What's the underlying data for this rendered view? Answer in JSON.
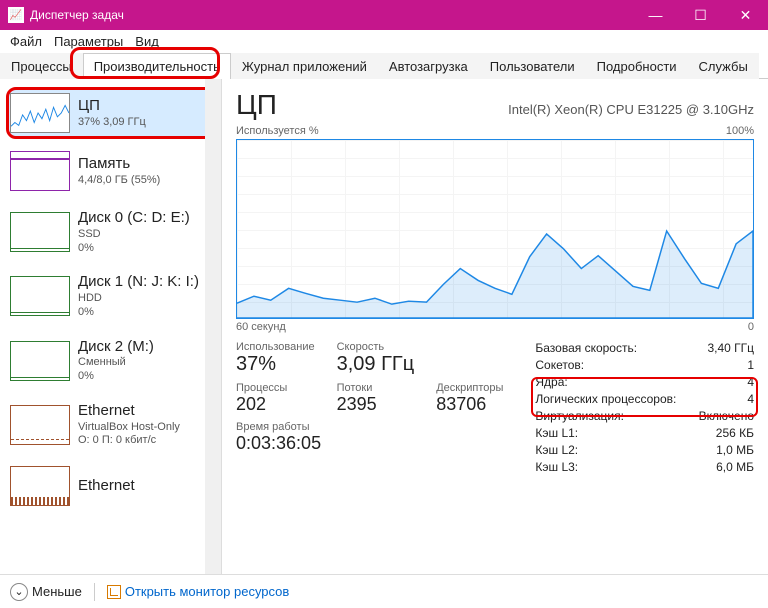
{
  "window": {
    "title": "Диспетчер задач"
  },
  "menu": {
    "file": "Файл",
    "options": "Параметры",
    "view": "Вид"
  },
  "tabs": {
    "processes": "Процессы",
    "performance": "Производительность",
    "app_history": "Журнал приложений",
    "startup": "Автозагрузка",
    "users": "Пользователи",
    "details": "Подробности",
    "services": "Службы"
  },
  "sidebar": {
    "cpu": {
      "name": "ЦП",
      "sub": "37% 3,09 ГГц"
    },
    "mem": {
      "name": "Память",
      "sub": "4,4/8,0 ГБ (55%)"
    },
    "disk0": {
      "name": "Диск 0 (C: D: E:)",
      "sub1": "SSD",
      "sub2": "0%"
    },
    "disk1": {
      "name": "Диск 1 (N: J: K: I:)",
      "sub1": "HDD",
      "sub2": "0%"
    },
    "disk2": {
      "name": "Диск 2 (M:)",
      "sub1": "Сменный",
      "sub2": "0%"
    },
    "eth": {
      "name": "Ethernet",
      "sub1": "VirtualBox Host-Only",
      "sub2": "О: 0 П: 0 кбит/с"
    },
    "eth2": {
      "name": "Ethernet"
    }
  },
  "main": {
    "title": "ЦП",
    "model": "Intel(R) Xeon(R) CPU E31225 @ 3.10GHz",
    "graph_top_left": "Используется %",
    "graph_top_right": "100%",
    "graph_bottom_left": "60 секунд",
    "graph_bottom_right": "0",
    "utilization_label": "Использование",
    "utilization_value": "37%",
    "speed_label": "Скорость",
    "speed_value": "3,09 ГГц",
    "processes_label": "Процессы",
    "processes_value": "202",
    "threads_label": "Потоки",
    "threads_value": "2395",
    "handles_label": "Дескрипторы",
    "handles_value": "83706",
    "uptime_label": "Время работы",
    "uptime_value": "0:03:36:05",
    "base_speed_label": "Базовая скорость:",
    "base_speed_value": "3,40 ГГц",
    "sockets_label": "Сокетов:",
    "sockets_value": "1",
    "cores_label": "Ядра:",
    "cores_value": "4",
    "lps_label": "Логических процессоров:",
    "lps_value": "4",
    "virt_label": "Виртуализация:",
    "virt_value": "Включено",
    "l1_label": "Кэш L1:",
    "l1_value": "256 КБ",
    "l2_label": "Кэш L2:",
    "l2_value": "1,0 МБ",
    "l3_label": "Кэш L3:",
    "l3_value": "6,0 МБ"
  },
  "footer": {
    "less": "Меньше",
    "open_monitor": "Открыть монитор ресурсов"
  },
  "chart_data": {
    "type": "line",
    "title": "Используется %",
    "xlabel": "60 секунд",
    "ylabel": "%",
    "ylim": [
      0,
      100
    ],
    "x_seconds_ago": [
      60,
      58,
      56,
      54,
      52,
      50,
      48,
      46,
      44,
      42,
      40,
      38,
      36,
      34,
      32,
      30,
      28,
      26,
      24,
      22,
      20,
      18,
      16,
      14,
      12,
      10,
      8,
      6,
      4,
      2,
      0
    ],
    "values": [
      10,
      14,
      12,
      18,
      15,
      13,
      11,
      10,
      12,
      9,
      11,
      10,
      20,
      28,
      22,
      18,
      15,
      35,
      48,
      40,
      30,
      36,
      28,
      20,
      18,
      50,
      35,
      22,
      20,
      42,
      50
    ]
  }
}
